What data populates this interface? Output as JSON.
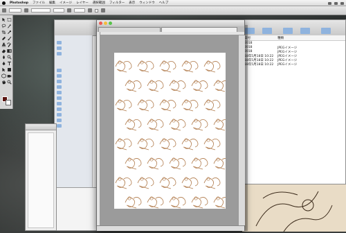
{
  "menubar": {
    "app_name": "Photoshop",
    "items": [
      "ファイル",
      "編集",
      "イメージ",
      "レイヤー",
      "選択範囲",
      "フィルター",
      "表示",
      "ウィンドウ",
      "ヘルプ"
    ]
  },
  "options_bar": {
    "size_value": "",
    "mode_value": "",
    "opacity_value": "",
    "flow_value": ""
  },
  "colors": {
    "foreground": "#5a1410",
    "background": "#ffffff",
    "pattern_stroke": "#b07a4a"
  },
  "finder": {
    "columns": {
      "date": "日付",
      "kind": "種類"
    },
    "rows": [
      {
        "date": "2018",
        "kind": ""
      },
      {
        "date": "2018",
        "kind": "JPEGイメージ"
      },
      {
        "date": "2018",
        "kind": "JPEGイメージ"
      },
      {
        "date": "18年5月18日 10:22",
        "kind": "JPEGイメージ"
      },
      {
        "date": "18年5月18日 10:22",
        "kind": "JPEGイメージ"
      },
      {
        "date": "18年5月18日 10:22",
        "kind": "JPEGイメージ"
      }
    ]
  },
  "palette": {
    "title": ""
  },
  "document": {
    "title": "",
    "tabs": [
      "",
      ""
    ],
    "status": ""
  }
}
